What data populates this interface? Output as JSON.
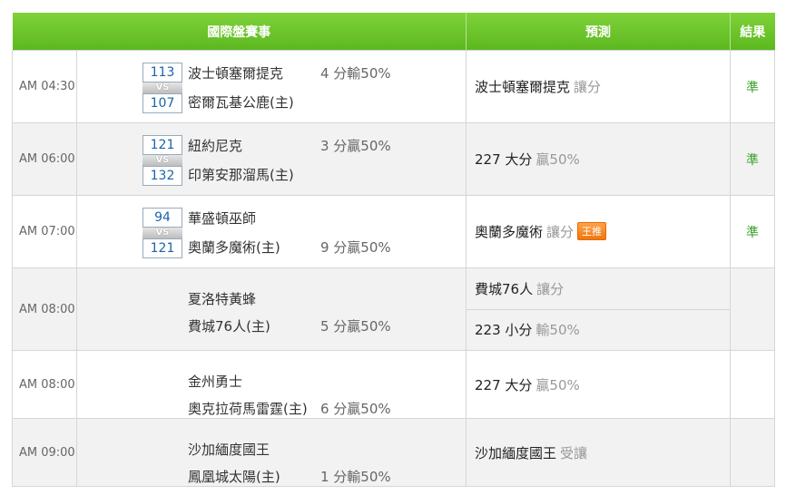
{
  "header": {
    "match": "國際盤賽事",
    "predict": "預測",
    "result": "結果"
  },
  "vs_label": "VS",
  "rows": [
    {
      "time": "AM 04:30",
      "away": "波士頓塞爾提克",
      "away_score": "113",
      "home": "密爾瓦基公鹿(主)",
      "home_score": "107",
      "outcome": "4 分輸50%",
      "outcome_line": "away",
      "preds": [
        {
          "text": "波士頓塞爾提克",
          "sub": "讓分",
          "badge": ""
        }
      ],
      "result": "準"
    },
    {
      "time": "AM 06:00",
      "away": "紐約尼克",
      "away_score": "121",
      "home": "印第安那溜馬(主)",
      "home_score": "132",
      "outcome": "3 分贏50%",
      "outcome_line": "away",
      "preds": [
        {
          "text": "227 大分",
          "sub": "贏50%",
          "badge": ""
        }
      ],
      "result": "準"
    },
    {
      "time": "AM 07:00",
      "away": "華盛頓巫師",
      "away_score": "94",
      "home": "奧蘭多魔術(主)",
      "home_score": "121",
      "outcome": "9 分贏50%",
      "outcome_line": "home",
      "preds": [
        {
          "text": "奧蘭多魔術",
          "sub": "讓分",
          "badge": "王推"
        }
      ],
      "result": "準"
    },
    {
      "time": "AM 08:00",
      "away": "夏洛特黃蜂",
      "away_score": "",
      "home": "費城76人(主)",
      "home_score": "",
      "outcome": "5 分贏50%",
      "outcome_line": "home",
      "preds": [
        {
          "text": "費城76人",
          "sub": "讓分",
          "badge": ""
        },
        {
          "text": "223 小分",
          "sub": "輸50%",
          "badge": ""
        }
      ],
      "result": ""
    },
    {
      "time": "AM 08:00",
      "away": "金州勇士",
      "away_score": "",
      "home": "奧克拉荷馬雷霆(主)",
      "home_score": "",
      "outcome": "6 分贏50%",
      "outcome_line": "home",
      "preds": [
        {
          "text": "227 大分",
          "sub": "贏50%",
          "badge": ""
        }
      ],
      "result": ""
    },
    {
      "time": "AM 09:00",
      "away": "沙加緬度國王",
      "away_score": "",
      "home": "鳳凰城太陽(主)",
      "home_score": "",
      "outcome": "1 分輸50%",
      "outcome_line": "home",
      "preds": [
        {
          "text": "沙加緬度國王",
          "sub": "受讓",
          "badge": ""
        }
      ],
      "result": ""
    }
  ]
}
